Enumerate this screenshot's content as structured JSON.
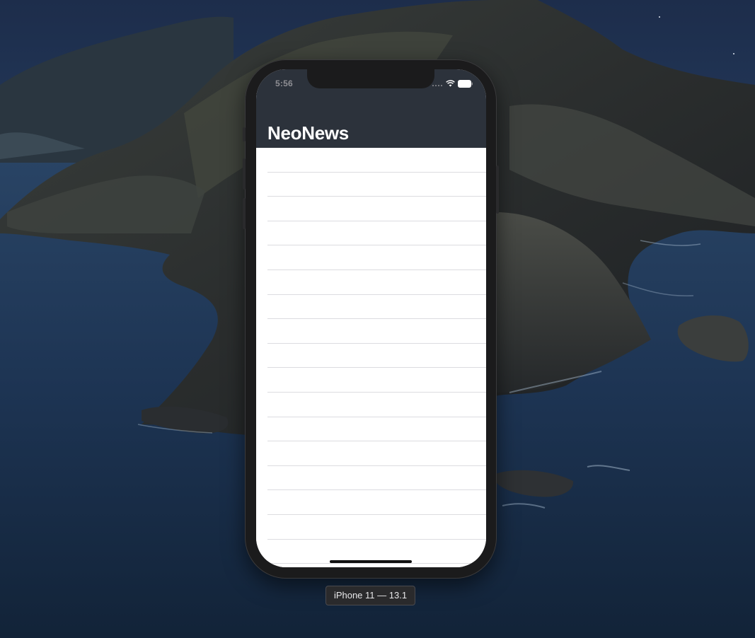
{
  "desktop": {
    "wallpaper_icon": "catalina-island-wallpaper"
  },
  "simulator": {
    "device_label": "iPhone 11 — 13.1",
    "status_bar": {
      "time": "5:56",
      "icons": [
        "signal-icon",
        "wifi-icon",
        "battery-icon"
      ]
    },
    "app": {
      "nav_title": "NeoNews",
      "nav_color": "#2c323b",
      "table_rows": [
        {
          "text": ""
        },
        {
          "text": ""
        },
        {
          "text": ""
        },
        {
          "text": ""
        },
        {
          "text": ""
        },
        {
          "text": ""
        },
        {
          "text": ""
        },
        {
          "text": ""
        },
        {
          "text": ""
        },
        {
          "text": ""
        },
        {
          "text": ""
        },
        {
          "text": ""
        },
        {
          "text": ""
        },
        {
          "text": ""
        },
        {
          "text": ""
        },
        {
          "text": ""
        },
        {
          "text": ""
        }
      ]
    }
  }
}
